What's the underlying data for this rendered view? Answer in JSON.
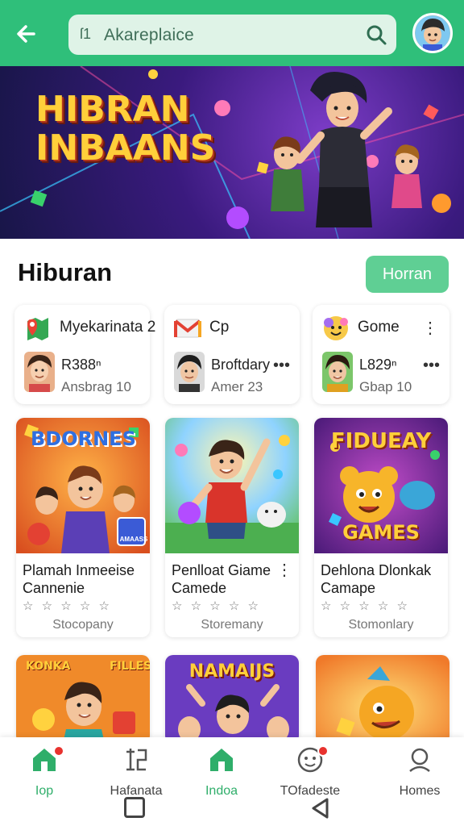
{
  "topbar": {
    "search_text": "Akareplaice",
    "search_prefix": "ſ1",
    "accent": "#2fbf7a"
  },
  "hero": {
    "title": "HIBRAN INBAANS"
  },
  "section": {
    "title": "Hiburan",
    "button_label": "Horran"
  },
  "mini_cards": [
    {
      "name": "Myekarinata 2",
      "line1": "R388ⁿ",
      "line2": "Ansbrag 10",
      "icon": "maps-pin-icon"
    },
    {
      "name": "Cp",
      "line1": "Broftdary",
      "line2": "Amer 23",
      "icon": "mail-icon"
    },
    {
      "name": "Gome",
      "line1": "L829ⁿ",
      "line2": "Gbap 10",
      "icon": "game-face-icon"
    }
  ],
  "cards": [
    {
      "image_text": "BDORNES",
      "image_tag": "AMAASS",
      "title": "Plamah Inmeeise Cannenie",
      "stars": "☆ ☆ ☆ ☆ ☆",
      "sub": "Stocopany"
    },
    {
      "title": "Penlloat Giame Camede",
      "stars": "☆ ☆ ☆ ☆ ☆",
      "sub": "Storemany",
      "more": "⋮"
    },
    {
      "image_text": "FIDUEAY",
      "image_sub": "GAMES",
      "title": "Dehlona Dlonkak Camape",
      "stars": "☆ ☆ ☆ ☆ ☆",
      "sub": "Stomonlary"
    }
  ],
  "cards_row2": [
    {
      "image_text": "KONKA",
      "image_tag": "FILLES"
    },
    {
      "image_text": "NAMAIJS"
    },
    {
      "image_text": ""
    }
  ],
  "nav": [
    {
      "label": "Iop",
      "icon": "home-icon",
      "active": true
    },
    {
      "label": "Hafanata",
      "icon": "apps-icon",
      "active": false
    },
    {
      "label": "Indoa",
      "icon": "home-icon",
      "active": true
    },
    {
      "label": "TOfadeste",
      "icon": "notifications-icon",
      "active": false
    },
    {
      "label": "Homes",
      "icon": "profile-icon",
      "active": false
    }
  ]
}
